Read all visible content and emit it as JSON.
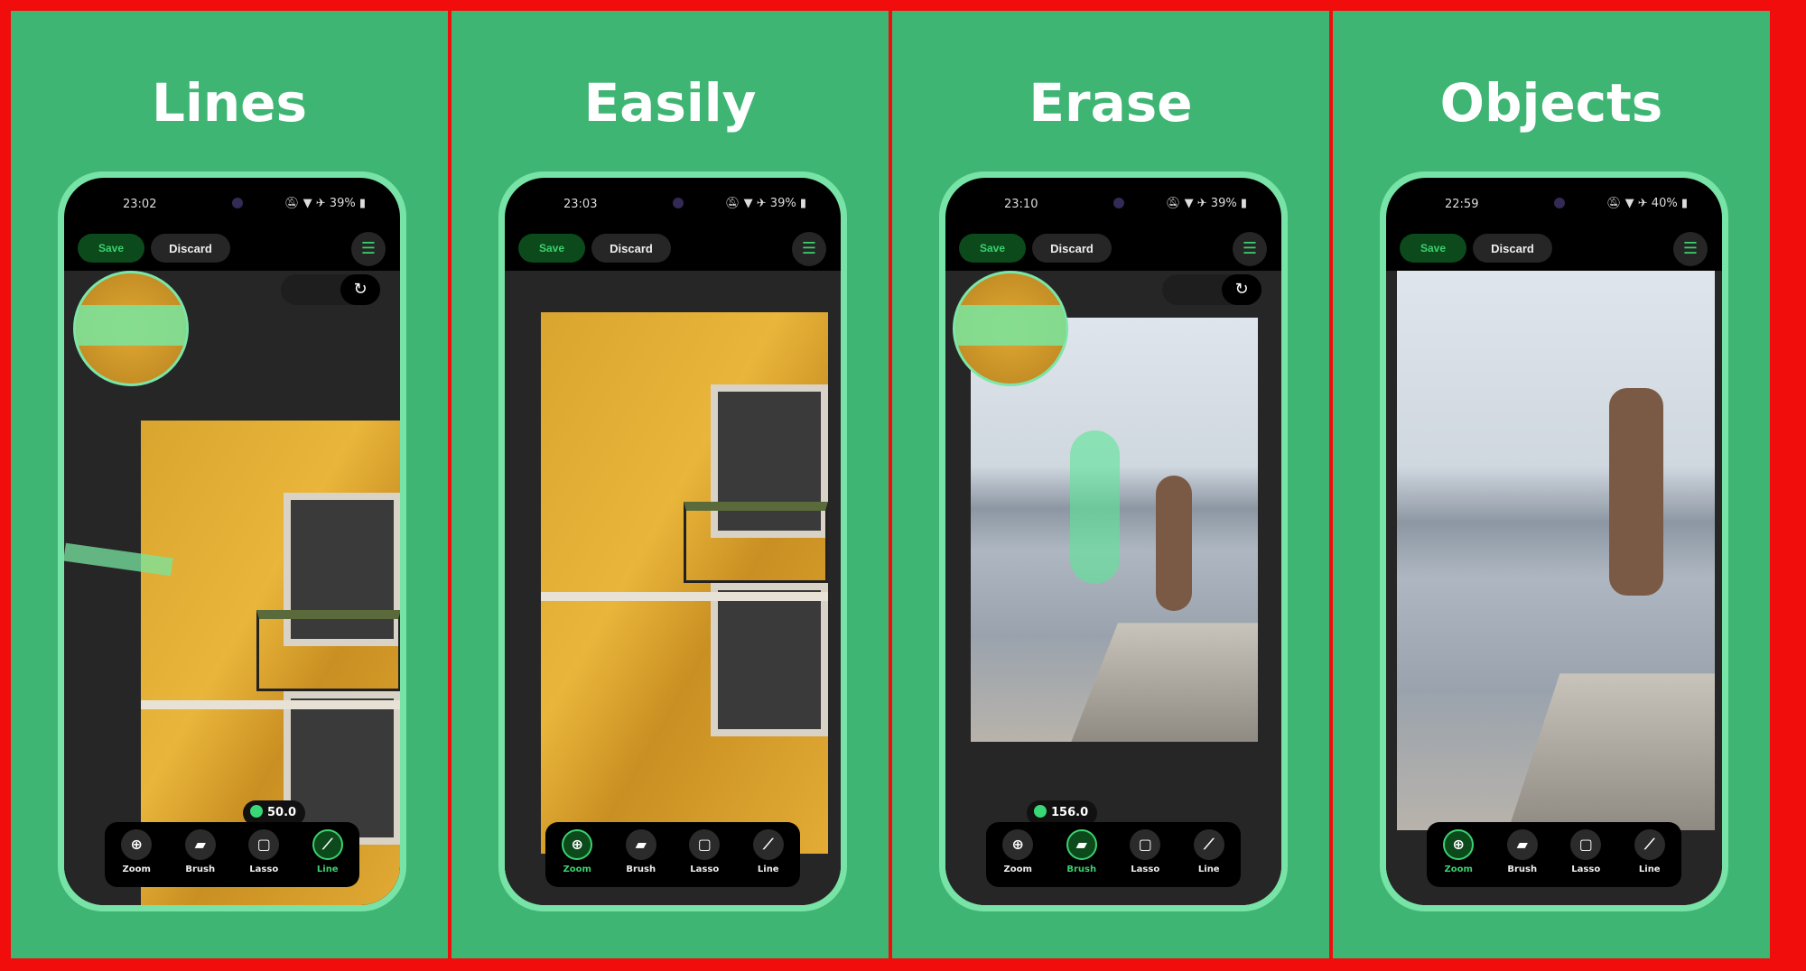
{
  "panels": [
    {
      "title": "Lines",
      "time": "23:02",
      "battery": "39%",
      "save": "Save",
      "discard": "Discard",
      "photo": "building",
      "magnifier": true,
      "redo": true,
      "size_value": "50.0",
      "active_tool": 3
    },
    {
      "title": "Easily",
      "time": "23:03",
      "battery": "39%",
      "save": "Save",
      "discard": "Discard",
      "photo": "building",
      "magnifier": false,
      "redo": false,
      "size_value": null,
      "active_tool": 0
    },
    {
      "title": "Erase",
      "time": "23:10",
      "battery": "39%",
      "save": "Save",
      "discard": "Discard",
      "photo": "lake",
      "magnifier": true,
      "redo": true,
      "size_value": "156.0",
      "active_tool": 1
    },
    {
      "title": "Objects",
      "time": "22:59",
      "battery": "40%",
      "save": "Save",
      "discard": "Discard",
      "photo": "lake",
      "magnifier": false,
      "redo": false,
      "size_value": null,
      "active_tool": 0
    }
  ],
  "tools": [
    {
      "label": "Zoom",
      "icon": "zoom-in-icon",
      "glyph": "⊕"
    },
    {
      "label": "Brush",
      "icon": "eraser-icon",
      "glyph": "▰"
    },
    {
      "label": "Lasso",
      "icon": "lasso-icon",
      "glyph": "▢"
    },
    {
      "label": "Line",
      "icon": "line-icon",
      "glyph": "⟋"
    }
  ],
  "colors": {
    "background": "#3fb574",
    "border": "#f20d0d",
    "accent": "#3bd16f"
  }
}
